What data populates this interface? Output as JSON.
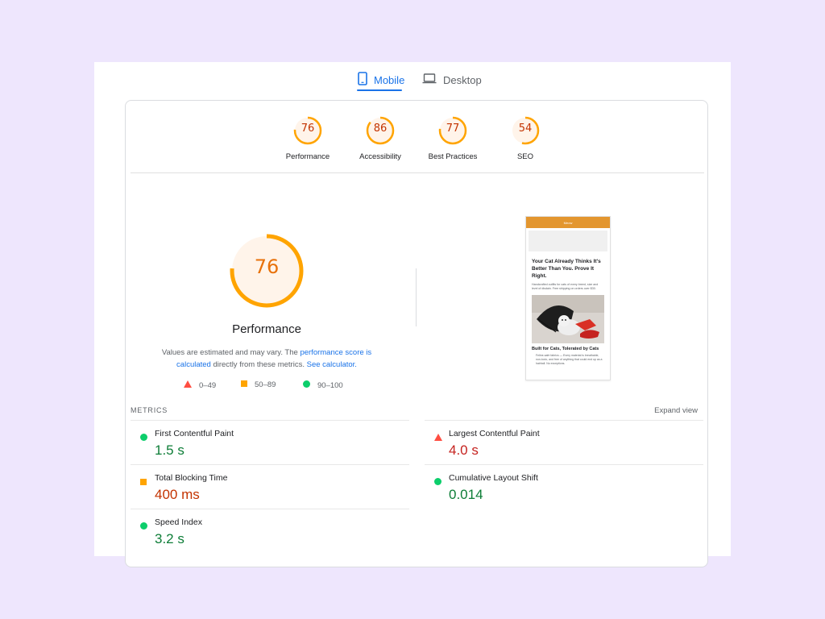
{
  "tabs": {
    "mobile_label": "Mobile",
    "desktop_label": "Desktop"
  },
  "scores": [
    {
      "label": "Performance",
      "value": 76
    },
    {
      "label": "Accessibility",
      "value": 86
    },
    {
      "label": "Best Practices",
      "value": 77
    },
    {
      "label": "SEO",
      "value": 54
    }
  ],
  "performance": {
    "score": 76,
    "title": "Performance",
    "desc_text1": "Values are estimated and may vary. The ",
    "desc_link1": "performance score is calculated",
    "desc_text2": " directly from these metrics. ",
    "desc_link2": "See calculator."
  },
  "legend": {
    "bad": "0–49",
    "average": "50–89",
    "good": "90–100"
  },
  "thumbnail": {
    "bar_text": "Meow",
    "heading": "Your Cat Already Thinks It's Better Than You. Prove It Right.",
    "paragraph": "Handcrafted outfits for cats of every breed, size and level of disdain. Free shipping on orders over $30.",
    "subheading": "Built for Cats, Tolerated by Cats",
    "list_item": "Feline-safe fabrics — Every material is breathable, non-toxic, and free of anything that could end up as a hairball. No exceptions."
  },
  "metrics": {
    "title": "METRICS",
    "expand_label": "Expand view",
    "items": [
      {
        "label": "First Contentful Paint",
        "value": "1.5 s",
        "rating": "good"
      },
      {
        "label": "Largest Contentful Paint",
        "value": "4.0 s",
        "rating": "bad"
      },
      {
        "label": "Total Blocking Time",
        "value": "400 ms",
        "rating": "average"
      },
      {
        "label": "Cumulative Layout Shift",
        "value": "0.014",
        "rating": "good"
      },
      {
        "label": "Speed Index",
        "value": "3.2 s",
        "rating": "good"
      }
    ]
  },
  "colors": {
    "accent": "#1a73e8",
    "good": "#0cce6b",
    "average": "#ffa400",
    "bad": "#ff4e42",
    "average_text": "#c33300",
    "page_bg": "#eee6fd"
  },
  "icons": {
    "mobile": "phone-icon",
    "desktop": "laptop-icon"
  }
}
